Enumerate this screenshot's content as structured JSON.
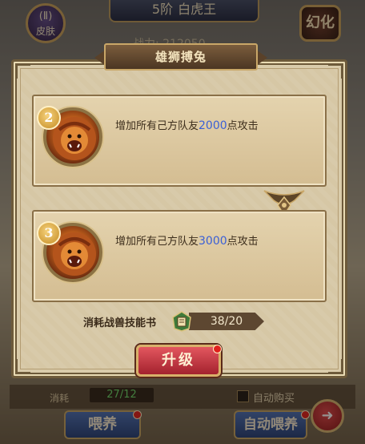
{
  "background": {
    "top_banner": {
      "level": "5阶",
      "name": "白虎王"
    },
    "skin_button": {
      "glyph": "(Ⅱ)",
      "label": "皮肤"
    },
    "morph_button": {
      "label": "幻化"
    },
    "power_text": "战力: 212050",
    "bottom": {
      "consume_label": "消耗",
      "consume_count": "27/12",
      "auto_buy_label": "自动购买",
      "feed_button": "喂养",
      "auto_feed_button": "自动喂养",
      "share_glyph": "➜"
    }
  },
  "modal": {
    "title": "雄狮搏兔",
    "skills": [
      {
        "level": "2",
        "desc_prefix": "增加所有己方队友",
        "value": "2000",
        "desc_suffix": "点攻击"
      },
      {
        "level": "3",
        "desc_prefix": "增加所有己方队友",
        "value": "3000",
        "desc_suffix": "点攻击"
      }
    ],
    "consume": {
      "label": "消耗战兽技能书",
      "count": "38/20"
    },
    "upgrade_button": "升级"
  },
  "colors": {
    "value_highlight": "#3a5fd6",
    "accent_red": "#c8303a",
    "frame": "#6d5a3a"
  }
}
